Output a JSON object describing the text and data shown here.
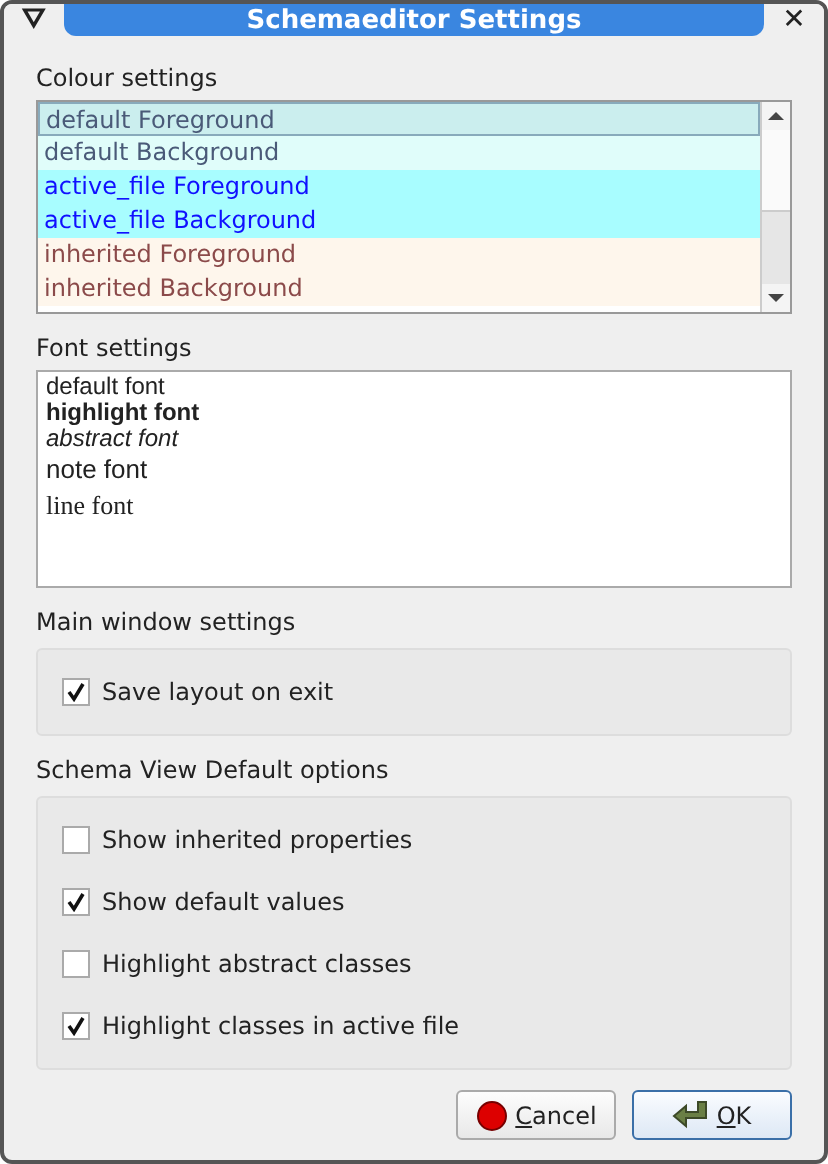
{
  "window": {
    "title": "Schemaeditor Settings",
    "menu_glyph": "⛛",
    "close_glyph": "✕"
  },
  "colour_settings": {
    "label": "Colour settings",
    "items": [
      {
        "label": "default Foreground",
        "color": "#4a5a78",
        "kind": "default",
        "selected": true
      },
      {
        "label": "default Background",
        "color": "#4a5a78",
        "kind": "default",
        "selected": false
      },
      {
        "label": "active_file Foreground",
        "color": "#1010ff",
        "kind": "active",
        "selected": false
      },
      {
        "label": "active_file Background",
        "color": "#1010ff",
        "kind": "active",
        "selected": false
      },
      {
        "label": "inherited Foreground",
        "color": "#8b4a4a",
        "kind": "inherited",
        "selected": false
      },
      {
        "label": "inherited Background",
        "color": "#8b4a4a",
        "kind": "inherited",
        "selected": false
      }
    ]
  },
  "font_settings": {
    "label": "Font settings",
    "items": [
      {
        "label": "default font",
        "kind": "sans"
      },
      {
        "label": "highlight font",
        "kind": "bold"
      },
      {
        "label": "abstract font",
        "kind": "italic"
      },
      {
        "label": "note font",
        "kind": "large"
      },
      {
        "label": "line font",
        "kind": "serif"
      }
    ]
  },
  "main_window_settings": {
    "label": "Main window settings",
    "options": [
      {
        "label": "Save layout on exit",
        "checked": true
      }
    ]
  },
  "schema_view_options": {
    "label": "Schema View Default options",
    "options": [
      {
        "label": "Show inherited properties",
        "checked": false
      },
      {
        "label": "Show default values",
        "checked": true
      },
      {
        "label": "Highlight abstract classes",
        "checked": false
      },
      {
        "label": "Highlight classes in active file",
        "checked": true
      }
    ]
  },
  "buttons": [
    {
      "label": "Cancel",
      "kind": "cancel",
      "mnemonic": true
    },
    {
      "label": "OK",
      "kind": "ok",
      "mnemonic": true
    }
  ]
}
